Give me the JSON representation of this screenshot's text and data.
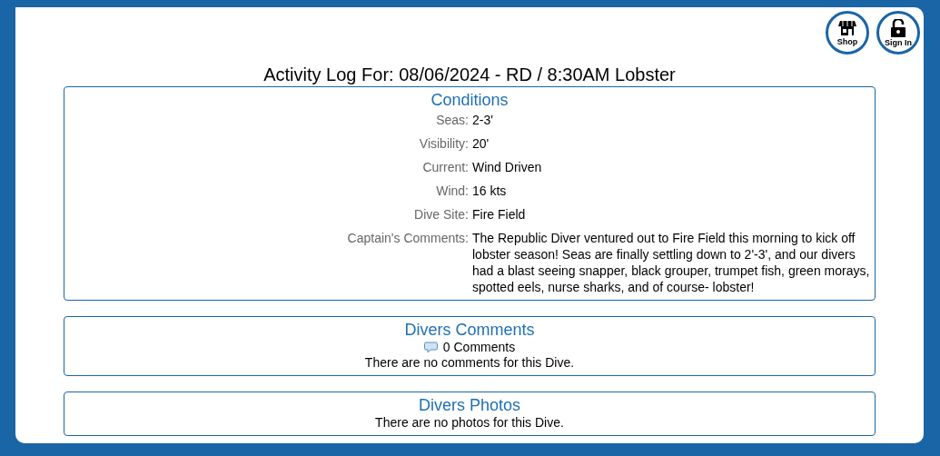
{
  "header_buttons": [
    {
      "kind": "shop",
      "label": "Shop"
    },
    {
      "kind": "signin",
      "label": "Sign In"
    }
  ],
  "title": "Activity Log For: 08/06/2024 - RD / 8:30AM Lobster",
  "conditions": {
    "heading": "Conditions",
    "rows": [
      {
        "label": "Seas:",
        "value": "2-3'"
      },
      {
        "label": "Visibility:",
        "value": "20'"
      },
      {
        "label": "Current:",
        "value": "Wind Driven"
      },
      {
        "label": "Wind:",
        "value": "16 kts"
      },
      {
        "label": "Dive Site:",
        "value": "Fire Field"
      },
      {
        "label": "Captain's Comments:",
        "value": "The Republic Diver ventured out to Fire Field this morning to kick off lobster season! Seas are finally settling down to 2'-3', and our divers had a blast seeing snapper, black grouper, trumpet fish, green morays, spotted eels, nurse sharks, and of course- lobster!"
      }
    ]
  },
  "comments": {
    "heading": "Divers Comments",
    "count": "0 Comments",
    "message": "There are no comments for this Dive."
  },
  "photos": {
    "heading": "Divers Photos",
    "message": "There are no photos for this Dive."
  }
}
